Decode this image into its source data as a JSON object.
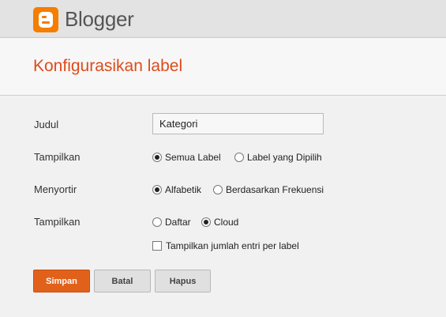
{
  "header": {
    "brand": "Blogger",
    "logo_icon": "blogger-logo-icon",
    "accent": "#f57d00"
  },
  "page_title": "Konfigurasikan label",
  "form": {
    "judul_label": "Judul",
    "judul_value": "Kategori",
    "tampilkan_label": "Tampilkan",
    "tampilkan_options": [
      {
        "label": "Semua Label",
        "checked": true
      },
      {
        "label": "Label yang Dipilih",
        "checked": false
      }
    ],
    "menyortir_label": "Menyortir",
    "menyortir_options": [
      {
        "label": "Alfabetik",
        "checked": true
      },
      {
        "label": "Berdasarkan Frekuensi",
        "checked": false
      }
    ],
    "display_label": "Tampilkan",
    "display_options": [
      {
        "label": "Daftar",
        "checked": false
      },
      {
        "label": "Cloud",
        "checked": true
      }
    ],
    "count_checkbox": {
      "label": "Tampilkan jumlah entri per label",
      "checked": false
    }
  },
  "buttons": {
    "save": "Simpan",
    "cancel": "Batal",
    "delete": "Hapus"
  }
}
